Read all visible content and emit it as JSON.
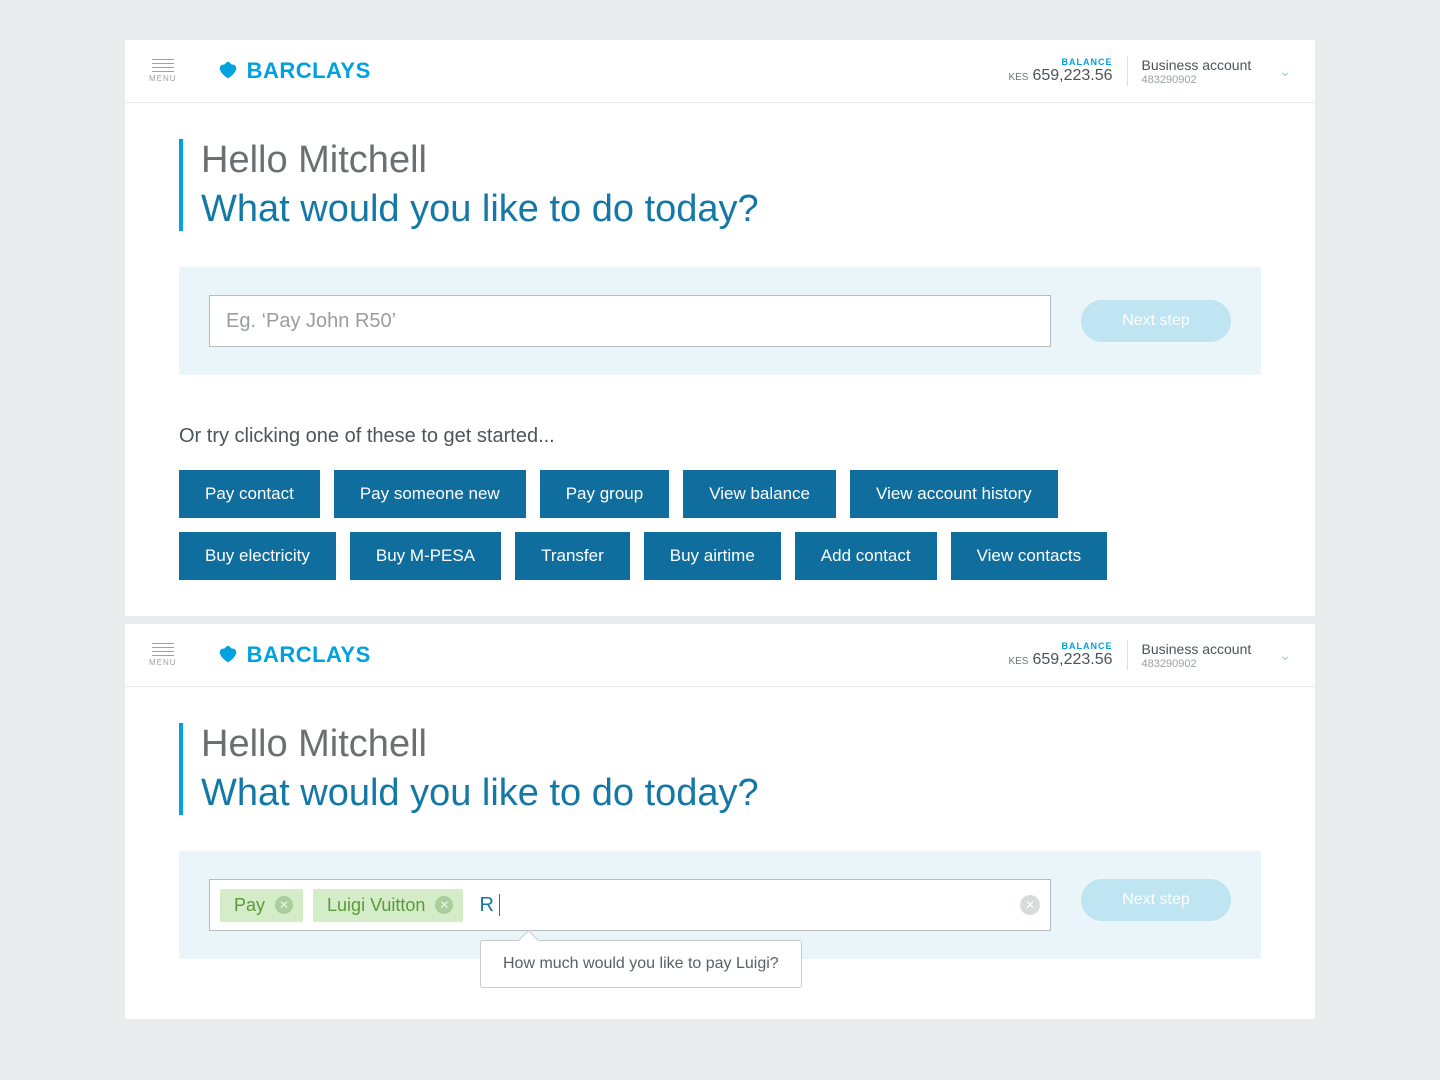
{
  "header": {
    "menu_label": "MENU",
    "brand": "BARCLAYS",
    "balance_label": "BALANCE",
    "currency": "KES",
    "balance_amount": "659,223.56",
    "account_name": "Business account",
    "account_number": "483290902"
  },
  "greeting": {
    "hello": "Hello Mitchell",
    "question": "What would you like to do today?"
  },
  "command": {
    "placeholder": "Eg. ‘Pay John R50’",
    "next_label": "Next step"
  },
  "suggestions": {
    "title": "Or try clicking one of these to get started...",
    "row1": [
      "Pay contact",
      "Pay someone new",
      "Pay group",
      "View balance",
      "View account history"
    ],
    "row2": [
      "Buy electricity",
      "Buy M-PESA",
      "Transfer",
      "Buy airtime",
      "Add contact",
      "View contacts"
    ]
  },
  "command2": {
    "tokens": [
      "Pay",
      "Luigi Vuitton"
    ],
    "typed": "R",
    "tooltip": "How much would you like to pay Luigi?"
  }
}
